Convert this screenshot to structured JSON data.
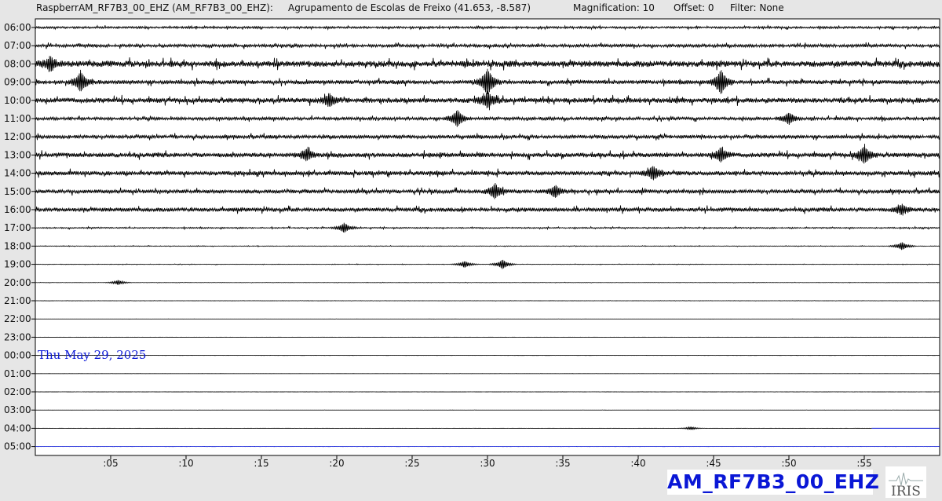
{
  "header": {
    "station": "RaspberrAM_RF7B3_00_EHZ (AM_RF7B3_00_EHZ):",
    "location": "Agrupamento de Escolas de Freixo (41.653, -8.587)",
    "magnification": "Magnification: 10",
    "offset": "Offset: 0",
    "filter": "Filter: None"
  },
  "date_label": "Thu May 29, 2025",
  "station_label": "AM_RF7B3_00_EHZ",
  "logo_text": "IRIS",
  "colors": {
    "background": "#e6e6e6",
    "plot_background": "#ffffff",
    "trace": "#000000",
    "accent": "#0a17d6"
  },
  "chart_data": {
    "type": "line",
    "chart_kind": "helicorder",
    "rows": [
      "06:00",
      "07:00",
      "08:00",
      "09:00",
      "10:00",
      "11:00",
      "12:00",
      "13:00",
      "14:00",
      "15:00",
      "16:00",
      "17:00",
      "18:00",
      "19:00",
      "20:00",
      "21:00",
      "22:00",
      "23:00",
      "00:00",
      "01:00",
      "02:00",
      "03:00",
      "04:00",
      "05:00"
    ],
    "x_ticks": [
      ":05",
      ":10",
      ":15",
      ":20",
      ":25",
      ":30",
      ":35",
      ":40",
      ":45",
      ":50",
      ":55"
    ],
    "x_tick_minutes": [
      5,
      10,
      15,
      20,
      25,
      30,
      35,
      40,
      45,
      50,
      55
    ],
    "xlim_minutes": [
      0,
      60
    ],
    "noise_level_per_row": [
      0.8,
      1.2,
      2.4,
      1.6,
      2.0,
      1.2,
      1.4,
      1.8,
      1.7,
      1.5,
      1.6,
      0.5,
      0.25,
      0.2,
      0.15,
      0.1,
      0.05,
      0.05,
      0.05,
      0.05,
      0.05,
      0.05,
      0.05,
      0.05
    ],
    "events": [
      {
        "row": "08:00",
        "minute": 1,
        "amplitude": 8
      },
      {
        "row": "09:00",
        "minute": 3,
        "amplitude": 12
      },
      {
        "row": "09:00",
        "minute": 30,
        "amplitude": 16
      },
      {
        "row": "09:00",
        "minute": 45.5,
        "amplitude": 14
      },
      {
        "row": "10:00",
        "minute": 30,
        "amplitude": 9
      },
      {
        "row": "10:00",
        "minute": 19.5,
        "amplitude": 7
      },
      {
        "row": "11:00",
        "minute": 28,
        "amplitude": 10
      },
      {
        "row": "11:00",
        "minute": 50,
        "amplitude": 7
      },
      {
        "row": "13:00",
        "minute": 18,
        "amplitude": 7
      },
      {
        "row": "13:00",
        "minute": 45.5,
        "amplitude": 8
      },
      {
        "row": "13:00",
        "minute": 55,
        "amplitude": 10
      },
      {
        "row": "14:00",
        "minute": 41,
        "amplitude": 8
      },
      {
        "row": "15:00",
        "minute": 30.5,
        "amplitude": 9
      },
      {
        "row": "15:00",
        "minute": 34.5,
        "amplitude": 7
      },
      {
        "row": "16:00",
        "minute": 57.5,
        "amplitude": 6
      },
      {
        "row": "17:00",
        "minute": 20.5,
        "amplitude": 6
      },
      {
        "row": "18:00",
        "minute": 57.5,
        "amplitude": 5
      },
      {
        "row": "19:00",
        "minute": 31,
        "amplitude": 6
      },
      {
        "row": "19:00",
        "minute": 28.5,
        "amplitude": 4
      },
      {
        "row": "20:00",
        "minute": 5.5,
        "amplitude": 3
      },
      {
        "row": "04:00",
        "minute": 43.5,
        "amplitude": 2
      }
    ],
    "current_row": "04:00",
    "current_minute": 55.5
  }
}
